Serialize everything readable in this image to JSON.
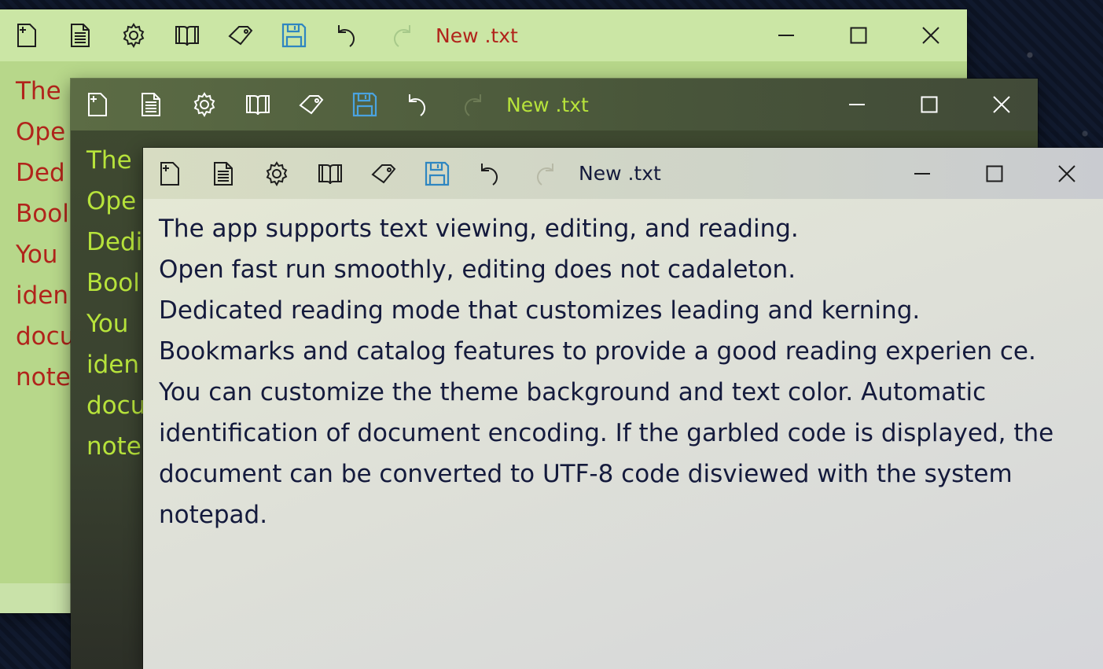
{
  "windows": [
    {
      "id": "back",
      "title": "New .txt",
      "text_color": "#b1241b",
      "lines": [
        "The",
        "Ope",
        "Ded",
        "Bool",
        "You",
        "iden",
        "docu",
        "note"
      ]
    },
    {
      "id": "middle",
      "title": "New .txt",
      "text_color": "#b7e33b",
      "lines": [
        "The",
        "Ope",
        "Dedi",
        "Bool",
        "You",
        "iden",
        "docu",
        "note"
      ]
    },
    {
      "id": "front",
      "title": "New .txt",
      "text_color": "#141a3c",
      "lines": [
        "The app supports text viewing, editing, and reading.",
        "Open fast run smoothly, editing does not cadaleton.",
        "Dedicated reading mode that customizes leading and kerning.",
        "Bookmarks and catalog features to provide a good reading experien ce.",
        "You can customize the theme background and text color. Automatic",
        "identification of document encoding. If the garbled code is displayed, the",
        "document can be converted to UTF-8 code disviewed with the system",
        "notepad."
      ]
    }
  ],
  "toolbar_icons": [
    "new-file-icon",
    "document-icon",
    "gear-icon",
    "book-icon",
    "tag-icon",
    "save-icon",
    "undo-icon",
    "redo-icon"
  ],
  "window_controls": [
    "minimize-icon",
    "maximize-icon",
    "close-icon"
  ],
  "accent_colors": {
    "save": "#2e86c1",
    "back_bg": "#b7d78a",
    "middle_bg": "#3f4a30",
    "front_bg": "#dfe1d8"
  }
}
